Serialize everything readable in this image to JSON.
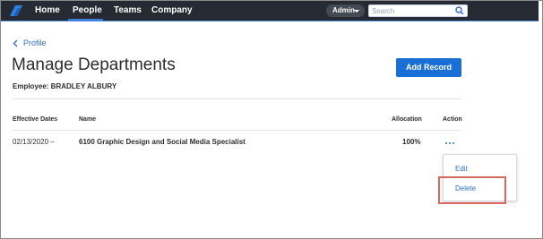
{
  "nav": {
    "items": [
      {
        "label": "Home"
      },
      {
        "label": "People",
        "active": true
      },
      {
        "label": "Teams"
      },
      {
        "label": "Company"
      }
    ],
    "admin_label": "Admin",
    "search_placeholder": "Search",
    "accent_color": "#3a7ddb",
    "bar_color": "#262b33"
  },
  "page": {
    "back_label": "Profile",
    "title": "Manage Departments",
    "employee": "Employee: BRADLEY ALBURY",
    "add_button": "Add Record"
  },
  "table": {
    "headers": {
      "effective_dates": "Effective Dates",
      "name": "Name",
      "allocation": "Allocation",
      "action": "Action"
    },
    "rows": [
      {
        "effective_dates": "02/13/2020 –",
        "name": "6100 Graphic Design and Social Media Specialist",
        "allocation": "100%"
      }
    ]
  },
  "menu": {
    "edit": "Edit",
    "delete": "Delete",
    "highlight_color": "#d9695f"
  }
}
